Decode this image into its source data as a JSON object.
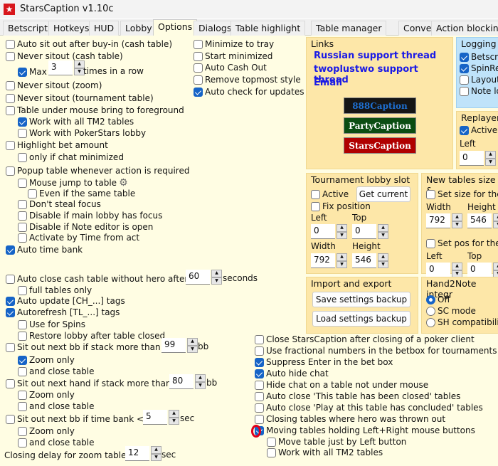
{
  "window": {
    "title": "StarsCaption v1.10c"
  },
  "tabs": [
    "Betscript",
    "Hotkeys",
    "HUD",
    "Lobby",
    "Options",
    "Dialogs",
    "Table highlight",
    "Table manager",
    "Convert chips",
    "Action blocking"
  ],
  "active_tab": "Options",
  "left_options": [
    {
      "label": "Auto sit out after buy-in (cash table)",
      "checked": false
    },
    {
      "label": "Never sitout (cash table)",
      "checked": false
    },
    {
      "label": "Max",
      "checked": true,
      "value": "3",
      "suffix": "times in a row"
    },
    {
      "label": "Never sitout (zoom)",
      "checked": false
    },
    {
      "label": "Never sitout (tournament table)",
      "checked": false
    },
    {
      "label": "Table under mouse bring to foreground",
      "checked": false
    },
    {
      "label": "Work with all TM2 tables",
      "checked": true
    },
    {
      "label": "Work with PokerStars lobby",
      "checked": false
    },
    {
      "label": "Highlight bet amount",
      "checked": false
    },
    {
      "label": "only if chat minimized",
      "checked": false
    },
    {
      "label": "Popup table whenever action is required",
      "checked": false
    },
    {
      "label": "Mouse jump to table",
      "checked": false,
      "icon": "gear-icon"
    },
    {
      "label": "Even if the same table",
      "checked": false
    },
    {
      "label": "Don't steal focus",
      "checked": false
    },
    {
      "label": "Disable if main lobby has focus",
      "checked": false
    },
    {
      "label": "Disable if Note editor is open",
      "checked": false
    },
    {
      "label": "Activate by Time from act",
      "checked": false
    },
    {
      "label": "Auto time bank",
      "checked": true
    },
    {
      "label": "Auto close cash table without hero after",
      "checked": false,
      "value": "60",
      "suffix": "seconds"
    },
    {
      "label": "full tables only",
      "checked": false
    },
    {
      "label": "Auto update [CH_...] tags",
      "checked": true
    },
    {
      "label": "Autorefresh [TL_...] tags",
      "checked": true
    },
    {
      "label": "Use for Spins",
      "checked": false
    },
    {
      "label": "Restore lobby after table closed",
      "checked": false
    },
    {
      "label": "Sit out next bb if stack more than",
      "checked": false,
      "value": "99",
      "suffix": "bb"
    },
    {
      "label": "Zoom only",
      "checked": true
    },
    {
      "label": "and close table",
      "checked": false
    },
    {
      "label": "Sit out next hand if stack more than",
      "checked": false,
      "value": "80",
      "suffix": "bb"
    },
    {
      "label": "Zoom only",
      "checked": false
    },
    {
      "label": "and close table",
      "checked": false
    },
    {
      "label": "Sit out next bb if time bank <",
      "checked": false,
      "value": "5",
      "suffix": "sec"
    },
    {
      "label": "Zoom only",
      "checked": false
    },
    {
      "label": "and close table",
      "checked": false
    },
    {
      "label": "Closing delay for zoom tables",
      "value": "12",
      "suffix": "sec"
    }
  ],
  "middle_options": [
    {
      "label": "Minimize to tray",
      "checked": false
    },
    {
      "label": "Start minimized",
      "checked": false
    },
    {
      "label": "Auto Cash Out",
      "checked": false
    },
    {
      "label": "Remove topmost style",
      "checked": false
    },
    {
      "label": "Auto check for updates",
      "checked": true
    }
  ],
  "bottom_options": [
    {
      "label": "Close StarsCaption after closing of a poker client",
      "checked": false
    },
    {
      "label": "Use fractional numbers in the betbox for tournaments",
      "checked": false
    },
    {
      "label": "Suppress Enter in the bet box",
      "checked": true
    },
    {
      "label": "Auto hide chat",
      "checked": true
    },
    {
      "label": "Hide chat on a table not under mouse",
      "checked": false
    },
    {
      "label": "Auto close 'This table has been closed' tables",
      "checked": false
    },
    {
      "label": "Auto close 'Play at this table has concluded' tables",
      "checked": false
    },
    {
      "label": "Closing tables where hero was thrown out",
      "checked": false
    },
    {
      "label": "Moving tables holding Left+Right mouse buttons",
      "checked": true
    },
    {
      "label": "Move table just by Left button",
      "checked": false
    },
    {
      "label": "Work with all TM2 tables",
      "checked": false
    }
  ],
  "links": {
    "title": "Links",
    "items": [
      "Russian support thread",
      "twoplustwo support thread",
      "Email"
    ],
    "brands": [
      {
        "label": "888Caption",
        "bg": "#151515",
        "fg": "#1e6fd0"
      },
      {
        "label": "PartyCaption",
        "bg": "#0b4d12",
        "fg": "#ffffff"
      },
      {
        "label": "StarsCaption",
        "bg": "#b00000",
        "fg": "#ffffff"
      }
    ]
  },
  "logging": {
    "title": "Logging",
    "items": [
      {
        "label": "Betscri",
        "checked": true
      },
      {
        "label": "SpinRe",
        "checked": true
      },
      {
        "label": "Layout",
        "checked": false
      },
      {
        "label": "Note lo",
        "checked": false
      }
    ]
  },
  "replayer": {
    "title": "Replayer s",
    "active": "Active",
    "active_checked": true,
    "left_label": "Left",
    "left_value": "0"
  },
  "tournament_lobby": {
    "title": "Tournament lobby slot",
    "active": "Active",
    "get_current": "Get current",
    "fix_position": "Fix position",
    "left_label": "Left",
    "left": "0",
    "top_label": "Top",
    "top": "0",
    "width_label": "Width",
    "width": "792",
    "height_label": "Height",
    "height": "546"
  },
  "new_tables": {
    "title": "New tables size &",
    "set_size": "Set size for the",
    "width_label": "Width",
    "width": "792",
    "height_label": "Height",
    "height": "546",
    "set_pos": "Set pos for the",
    "left_label": "Left",
    "left": "0",
    "top_label": "Top",
    "top": "0"
  },
  "import_export": {
    "title": "Import and export",
    "save": "Save settings backup",
    "load": "Load settings backup"
  },
  "hand2note": {
    "title": "Hand2Note integr",
    "options": [
      {
        "label": "Off",
        "selected": true
      },
      {
        "label": "SC mode",
        "selected": false
      },
      {
        "label": "SH compatibility",
        "selected": false
      }
    ]
  },
  "colors": {
    "panel": "#fffde3",
    "links_box": "#fde7a8",
    "logging_box": "#bfe3fa",
    "checked": "#1664c7",
    "link": "#1a1ae6",
    "annotation": "#e0001a"
  }
}
